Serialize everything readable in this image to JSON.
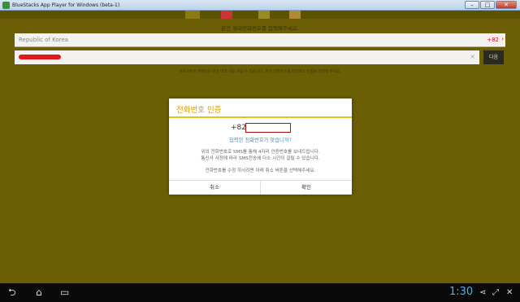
{
  "window": {
    "title": "BlueStacks App Player for Windows (beta-1)",
    "controls": [
      "–",
      "□",
      "✕"
    ]
  },
  "screen": {
    "prompt": "본인 휴대전화번호를 입력해주세요.",
    "country": {
      "name": "Republic of Korea",
      "code": "+82",
      "chevron": "›"
    },
    "phone": {
      "clear": "×"
    },
    "next_label": "다음",
    "notice": "카카오톡은 전화번호 인증 이후 사용 하실 수 있습니다. 본인 전화번호를 입력하고 인증을 진행해 주세요."
  },
  "dialog": {
    "title": "전화번호 인증",
    "prefix": "+82",
    "confirm": "입력한 전화번호가 맞습니까?",
    "line1": "위의 전화번호로 SMS를 통해 4자리 인증번호를 보내드립니다.",
    "line2": "통신사 사정에 따라 SMS전송에 다소 시간이 걸릴 수 있습니다.",
    "line3": "전화번호를 수정 하시려면 아래 취소 버튼을 선택해주세요.",
    "cancel": "취소",
    "ok": "확인"
  },
  "navbar": {
    "back": "⮌",
    "home": "⌂",
    "recent": "▭",
    "time": "1:30",
    "share": "⋖",
    "expand": "⤢",
    "close": "✕"
  },
  "colors": {
    "screen_bg": "#6b5e04",
    "accent": "#e9c21d",
    "title_text": "#d49a00",
    "link": "#4d8ab5",
    "redaction": "#e01818",
    "clock": "#4db3e6"
  }
}
